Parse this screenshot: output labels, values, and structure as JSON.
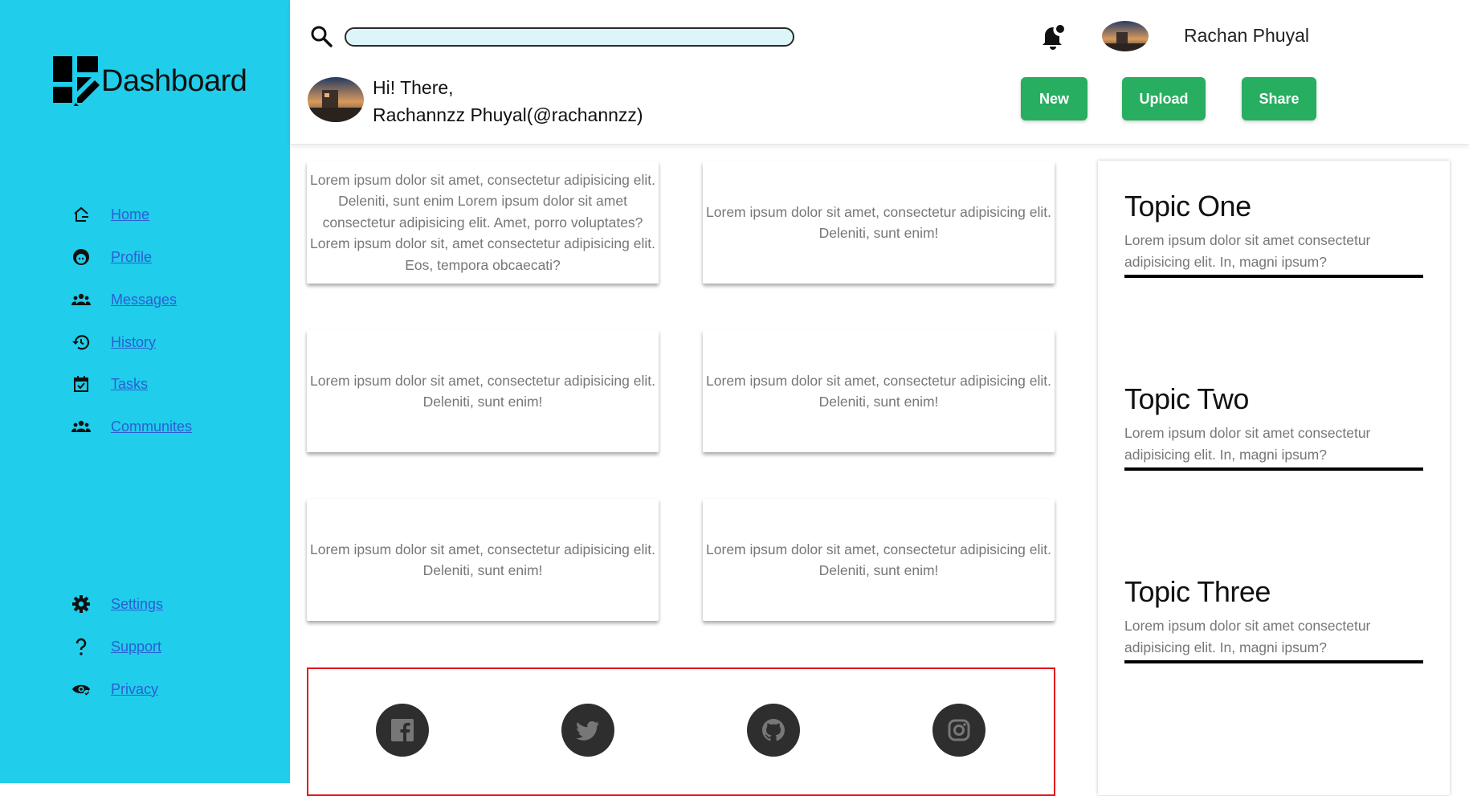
{
  "sidebar": {
    "brand": "Dashboard",
    "nav_main": [
      {
        "label": "Home",
        "icon": "home-icon"
      },
      {
        "label": "Profile",
        "icon": "profile-icon"
      },
      {
        "label": "Messages",
        "icon": "messages-icon"
      },
      {
        "label": "History",
        "icon": "history-icon"
      },
      {
        "label": "Tasks",
        "icon": "tasks-icon"
      },
      {
        "label": "Communites",
        "icon": "communities-icon"
      }
    ],
    "nav_bottom": [
      {
        "label": "Settings",
        "icon": "settings-icon"
      },
      {
        "label": "Support",
        "icon": "support-icon"
      },
      {
        "label": "Privacy",
        "icon": "privacy-icon"
      }
    ]
  },
  "header": {
    "search": {
      "placeholder": "",
      "value": ""
    },
    "user_name": "Rachan Phuyal",
    "greeting_line1": "Hi! There,",
    "greeting_line2": "Rachannzz Phuyal(@rachannzz)",
    "buttons": {
      "new": "New",
      "upload": "Upload",
      "share": "Share"
    }
  },
  "cards": [
    "Lorem ipsum dolor sit amet, consectetur adipisicing elit. Deleniti, sunt enim Lorem ipsum dolor sit amet consectetur adipisicing elit. Amet, porro voluptates?Lorem ipsum dolor sit, amet consectetur adipisicing elit. Eos, tempora obcaecati?",
    "Lorem ipsum dolor sit amet, consectetur adipisicing elit. Deleniti, sunt enim!",
    "Lorem ipsum dolor sit amet, consectetur adipisicing elit. Deleniti, sunt enim!",
    "Lorem ipsum dolor sit amet, consectetur adipisicing elit. Deleniti, sunt enim!",
    "Lorem ipsum dolor sit amet, consectetur adipisicing elit. Deleniti, sunt enim!",
    "Lorem ipsum dolor sit amet, consectetur adipisicing elit. Deleniti, sunt enim!"
  ],
  "social": [
    "facebook-icon",
    "twitter-icon",
    "github-icon",
    "instagram-icon"
  ],
  "topics": [
    {
      "title": "Topic One",
      "text": "Lorem ipsum dolor sit amet consectetur adipisicing elit. In, magni ipsum?"
    },
    {
      "title": "Topic Two",
      "text": "Lorem ipsum dolor sit amet consectetur adipisicing elit. In, magni ipsum?"
    },
    {
      "title": "Topic Three",
      "text": "Lorem ipsum dolor sit amet consectetur adipisicing elit. In, magni ipsum?"
    }
  ],
  "colors": {
    "sidebar_bg": "#20cdea",
    "button_green": "#27ae60",
    "link_blue": "#2a5fd4",
    "social_border": "#e3141b"
  }
}
